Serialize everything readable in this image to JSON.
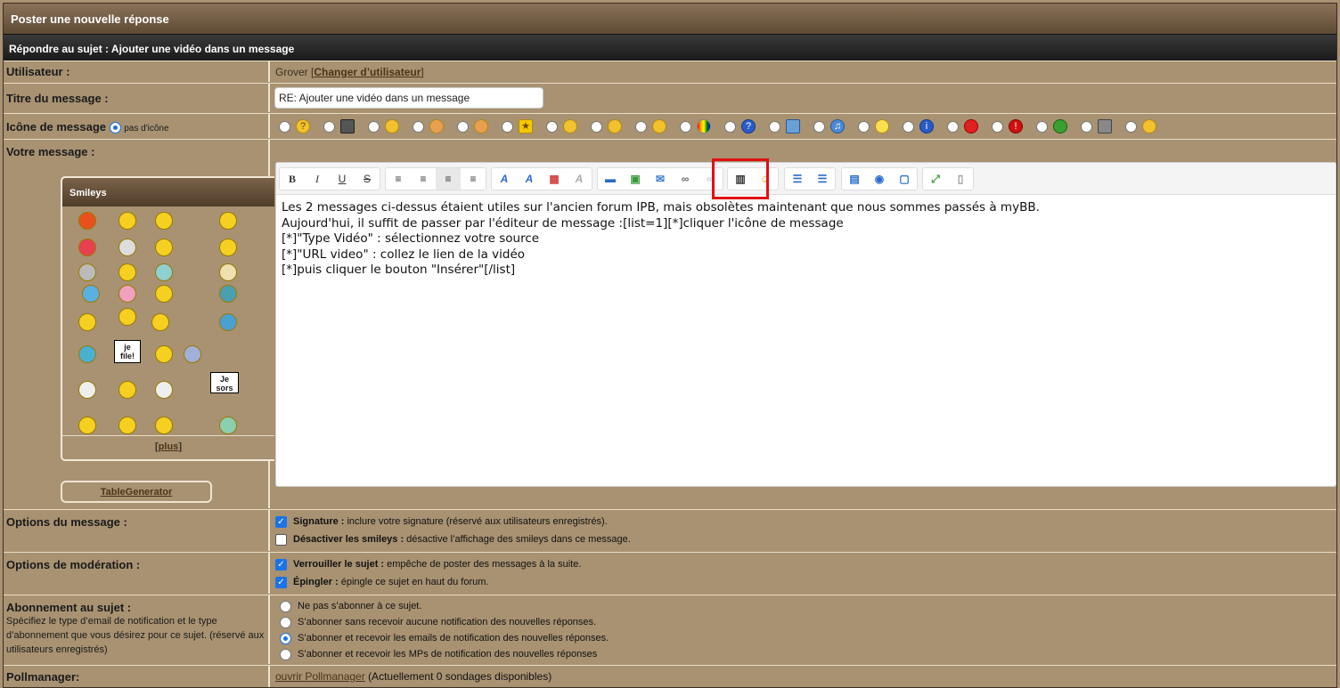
{
  "header": {
    "title": "Poster une nouvelle réponse",
    "subtitle": "Répondre au sujet : Ajouter une vidéo dans un message"
  },
  "user": {
    "label": "Utilisateur :",
    "name": "Grover",
    "change_prefix": "[",
    "change_link": "Changer d’utilisateur",
    "change_suffix": "]"
  },
  "title_field": {
    "label": "Titre du message :",
    "value": "RE: Ajouter une vidéo dans un message"
  },
  "icon_field": {
    "label": "Icône de message",
    "none_label": "pas d'icône"
  },
  "message": {
    "label": "Votre message :",
    "lines": [
      "Les 2 messages ci-dessus étaient utiles sur l'ancien forum IPB, mais obsolètes maintenant que nous sommes passés à myBB.",
      "Aujourd'hui, il suffit de passer par l'éditeur de message :[list=1][*]cliquer l'icône de message",
      "[*]\"Type Vidéo\" : sélectionnez votre source",
      "[*]\"URL video\" : collez le lien de la vidéo",
      "[*]puis cliquer le bouton \"Insérer\"[/list]"
    ]
  },
  "toolbar": {
    "bold": "B",
    "italic": "I",
    "underline": "U",
    "strike": "S"
  },
  "smileys": {
    "title": "Smileys",
    "more_prefix": "[",
    "more": "plus",
    "more_suffix": "]",
    "sign1": "je\nfile!",
    "sign2": "Je\nsors"
  },
  "table_generator": "TableGenerator",
  "options": {
    "label": "Options du message :",
    "signature_bold": "Signature :",
    "signature_text": "inclure votre signature (réservé aux utilisateurs enregistrés).",
    "smileys_bold": "Désactiver les smileys :",
    "smileys_text": "désactive l’affichage des smileys dans ce message."
  },
  "moderation": {
    "label": "Options de modération :",
    "lock_bold": "Verrouiller le sujet :",
    "lock_text": "empêche de poster des messages à la suite.",
    "pin_bold": "Épingler :",
    "pin_text": "épingle ce sujet en haut du forum."
  },
  "subscription": {
    "label": "Abonnement au sujet :",
    "help": "Spécifiez le type d’email de notification et le type d’abonnement que vous désirez pour ce sujet. (réservé aux utilisateurs enregistrés)",
    "opts": [
      "Ne pas s’abonner à ce sujet.",
      "S’abonner sans recevoir aucune notification des nouvelles réponses.",
      "S’abonner et recevoir les emails de notification des nouvelles réponses.",
      "S’abonner et recevoir les MPs de notification des nouvelles réponses"
    ]
  },
  "poll": {
    "label": "Pollmanager:",
    "link": "ouvrir Pollmanager",
    "status": "(Actuellement 0 sondages disponibles)"
  }
}
